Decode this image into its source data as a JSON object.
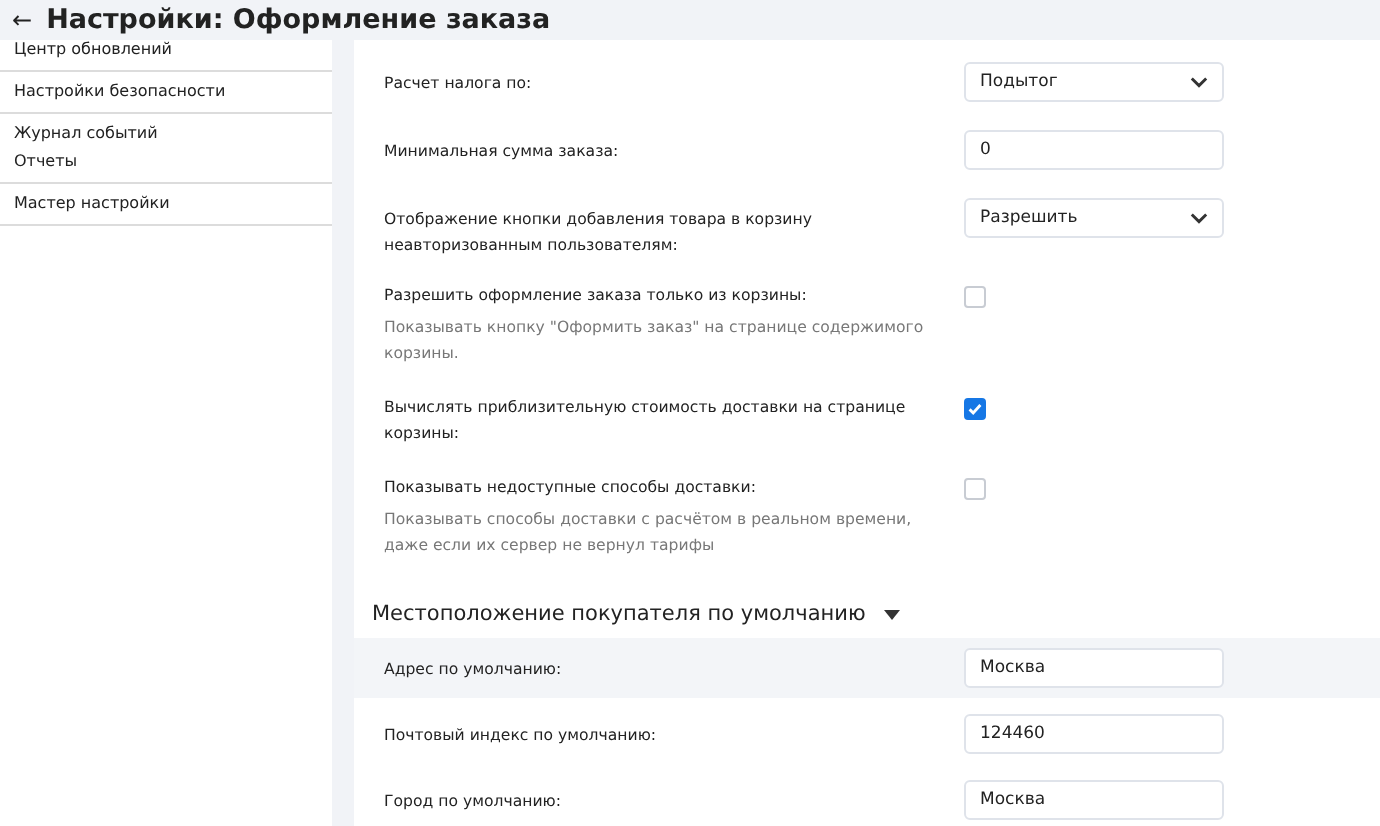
{
  "header": {
    "back": "←",
    "title": "Настройки: Оформление заказа"
  },
  "sidebar": {
    "groups": [
      {
        "items": [
          "Центр обновлений"
        ]
      },
      {
        "items": [
          "Настройки безопасности"
        ]
      },
      {
        "items": [
          "Журнал событий",
          "Отчеты"
        ]
      },
      {
        "items": [
          "Мастер настройки"
        ]
      }
    ]
  },
  "settings": [
    {
      "kind": "select",
      "label": "Расчет налога по:",
      "value": "Подытог"
    },
    {
      "kind": "input",
      "label": "Минимальная сумма заказа:",
      "value": "0"
    },
    {
      "kind": "select",
      "label": "Отображение кнопки добавления товара в корзину неавторизованным пользователям:",
      "value": "Разрешить"
    },
    {
      "kind": "checkbox",
      "label": "Разрешить оформление заказа только из корзины:",
      "description": "Показывать кнопку \"Оформить заказ\" на странице содержимого корзины.",
      "checked": false
    },
    {
      "kind": "checkbox",
      "label": "Вычислять приблизительную стоимость доставки на странице корзины:",
      "checked": true
    },
    {
      "kind": "checkbox",
      "label": "Показывать недоступные способы доставки:",
      "description": "Показывать способы доставки с расчётом в реальном времени, даже если их сервер не вернул тарифы",
      "checked": false
    }
  ],
  "location_section": {
    "title": "Местоположение покупателя по умолчанию",
    "expanded": true,
    "fields": [
      {
        "label": "Адрес по умолчанию:",
        "value": "Москва",
        "selected": true
      },
      {
        "label": "Почтовый индекс по умолчанию:",
        "value": "124460",
        "selected": false
      },
      {
        "label": "Город по умолчанию:",
        "value": "Москва",
        "selected": false
      }
    ]
  }
}
